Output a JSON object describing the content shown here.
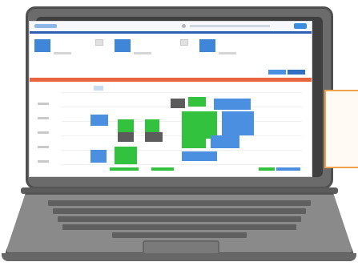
{
  "illustration": {
    "subject": "laptop-with-scheduling-dashboard",
    "colors": {
      "laptop_body": "#6b6b6b",
      "screen_bg": "#ffffff",
      "accent_blue": "#3f86d9",
      "accent_green": "#33c23e",
      "alert_red": "#e8653f",
      "sticker_border": "#f0a24a"
    }
  },
  "screen": {
    "header_text": "",
    "cards": [
      {
        "label": ""
      },
      {
        "label": ""
      },
      {
        "label": ""
      }
    ]
  }
}
